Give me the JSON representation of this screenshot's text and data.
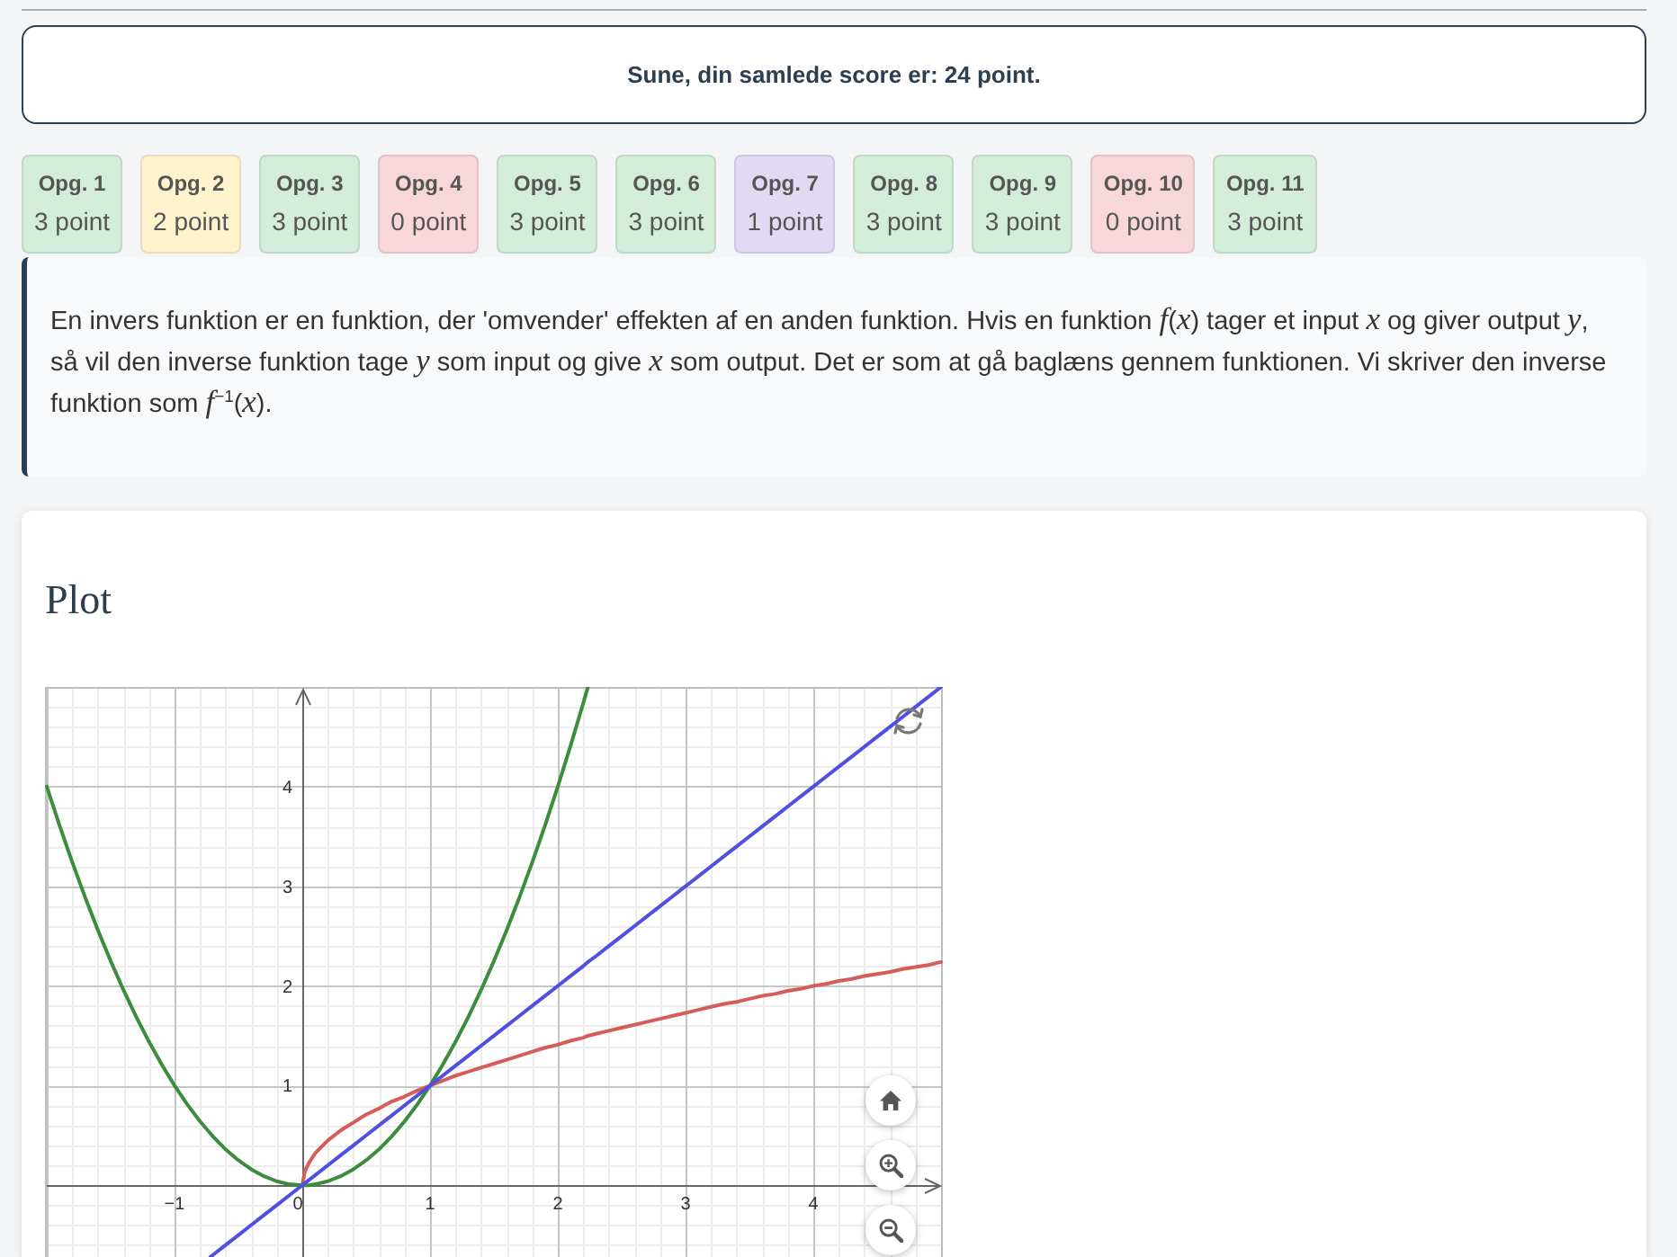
{
  "score_banner": {
    "text": "Sune, din samlede score er: 24 point."
  },
  "tasks": [
    {
      "label": "Opg. 1",
      "score": "3 point",
      "color": "#d4edda"
    },
    {
      "label": "Opg. 2",
      "score": "2 point",
      "color": "#fff3cd"
    },
    {
      "label": "Opg. 3",
      "score": "3 point",
      "color": "#d4edda"
    },
    {
      "label": "Opg. 4",
      "score": "0 point",
      "color": "#f8d7da"
    },
    {
      "label": "Opg. 5",
      "score": "3 point",
      "color": "#d4edda"
    },
    {
      "label": "Opg. 6",
      "score": "3 point",
      "color": "#d4edda"
    },
    {
      "label": "Opg. 7",
      "score": "1 point",
      "color": "#e2d9f3"
    },
    {
      "label": "Opg. 8",
      "score": "3 point",
      "color": "#d4edda"
    },
    {
      "label": "Opg. 9",
      "score": "3 point",
      "color": "#d4edda"
    },
    {
      "label": "Opg. 10",
      "score": "0 point",
      "color": "#f8d7da"
    },
    {
      "label": "Opg. 11",
      "score": "3 point",
      "color": "#d4edda"
    }
  ],
  "info": {
    "text": "En invers funktion er en funktion, der 'omvender' effekten af en anden funktion. Hvis en funktion *f*(*x*) tager et input *x* og giver output *y*, så vil den inverse funktion tage *y* som input og give *x* som output. Det er som at gå baglæns gennem funktionen. Vi skriver den inverse funktion som *f*$^{−1}$(*x*)."
  },
  "plot": {
    "heading": "Plot",
    "chart_data": {
      "type": "line",
      "grid": true,
      "x": [
        -2,
        -1.9,
        -1.8,
        -1.7,
        -1.6,
        -1.5,
        -1.4,
        -1.3,
        -1.2,
        -1.1,
        -1,
        -0.9,
        -0.8,
        -0.72,
        -0.7,
        -0.6,
        -0.5,
        -0.4,
        -0.3,
        -0.2,
        -0.1,
        0,
        0.02,
        0.05,
        0.1,
        0.2,
        0.3,
        0.4,
        0.5,
        0.6,
        0.7,
        0.8,
        0.9,
        1,
        1.1,
        1.2,
        1.3,
        1.4,
        1.5,
        1.6,
        1.7,
        1.8,
        1.9,
        2,
        2.1,
        2.2,
        2.236,
        2.3,
        2.4,
        2.5,
        2.6,
        2.7,
        2.8,
        2.9,
        3,
        3.1,
        3.2,
        3.3,
        3.4,
        3.5,
        3.6,
        3.7,
        3.8,
        3.9,
        4,
        4.1,
        4.2,
        4.3,
        4.4,
        4.5,
        4.6,
        4.7,
        4.8,
        4.9,
        5
      ],
      "series": [
        {
          "color": "#3c8c3c",
          "values": [
            4,
            3.61,
            3.24,
            2.89,
            2.56,
            2.25,
            1.96,
            1.69,
            1.44,
            1.21,
            1,
            0.81,
            0.64,
            0.52,
            0.49,
            0.36,
            0.25,
            0.16,
            0.09,
            0.04,
            0.01,
            0,
            0,
            0,
            0.01,
            0.04,
            0.09,
            0.16,
            0.25,
            0.36,
            0.49,
            0.64,
            0.81,
            1,
            1.21,
            1.44,
            1.69,
            1.96,
            2.25,
            2.56,
            2.89,
            3.24,
            3.61,
            4,
            4.41,
            4.84,
            5,
            null,
            null,
            null,
            null,
            null,
            null,
            null,
            null,
            null,
            null,
            null,
            null,
            null,
            null,
            null,
            null,
            null,
            null,
            null,
            null,
            null,
            null,
            null,
            null,
            null,
            null,
            null,
            null
          ]
        },
        {
          "color": "#d65c5c",
          "values": [
            null,
            null,
            null,
            null,
            null,
            null,
            null,
            null,
            null,
            null,
            null,
            null,
            null,
            null,
            null,
            null,
            null,
            null,
            null,
            null,
            null,
            0,
            0.14,
            0.22,
            0.32,
            0.45,
            0.55,
            0.63,
            0.71,
            0.77,
            0.84,
            0.89,
            0.95,
            1,
            1.05,
            1.1,
            1.14,
            1.18,
            1.22,
            1.26,
            1.3,
            1.34,
            1.38,
            1.41,
            1.45,
            1.48,
            1.5,
            1.52,
            1.55,
            1.58,
            1.61,
            1.64,
            1.67,
            1.7,
            1.73,
            1.76,
            1.79,
            1.82,
            1.84,
            1.87,
            1.9,
            1.92,
            1.95,
            1.97,
            2,
            2.02,
            2.05,
            2.07,
            2.1,
            2.12,
            2.14,
            2.17,
            2.19,
            2.21,
            2.24
          ]
        },
        {
          "color": "#5050e0",
          "values": [
            null,
            null,
            null,
            null,
            null,
            null,
            null,
            null,
            null,
            null,
            null,
            null,
            null,
            -0.72,
            -0.7,
            -0.6,
            -0.5,
            -0.4,
            -0.3,
            -0.2,
            -0.1,
            0,
            0.02,
            0.05,
            0.1,
            0.2,
            0.3,
            0.4,
            0.5,
            0.6,
            0.7,
            0.8,
            0.9,
            1,
            1.1,
            1.2,
            1.3,
            1.4,
            1.5,
            1.6,
            1.7,
            1.8,
            1.9,
            2,
            2.1,
            2.2,
            2.24,
            2.3,
            2.4,
            2.5,
            2.6,
            2.7,
            2.8,
            2.9,
            3,
            3.1,
            3.2,
            3.3,
            3.4,
            3.5,
            3.6,
            3.7,
            3.8,
            3.9,
            4,
            4.1,
            4.2,
            4.3,
            4.4,
            4.5,
            4.6,
            4.7,
            4.8,
            4.9,
            5
          ]
        }
      ],
      "xlim": [
        -2,
        5
      ],
      "ylim": [
        -0.72,
        5
      ],
      "xticks": [
        {
          "value": -1,
          "label": "−1"
        },
        0,
        1,
        2,
        3,
        4
      ],
      "yticks": [
        1,
        2,
        3,
        4
      ]
    }
  }
}
